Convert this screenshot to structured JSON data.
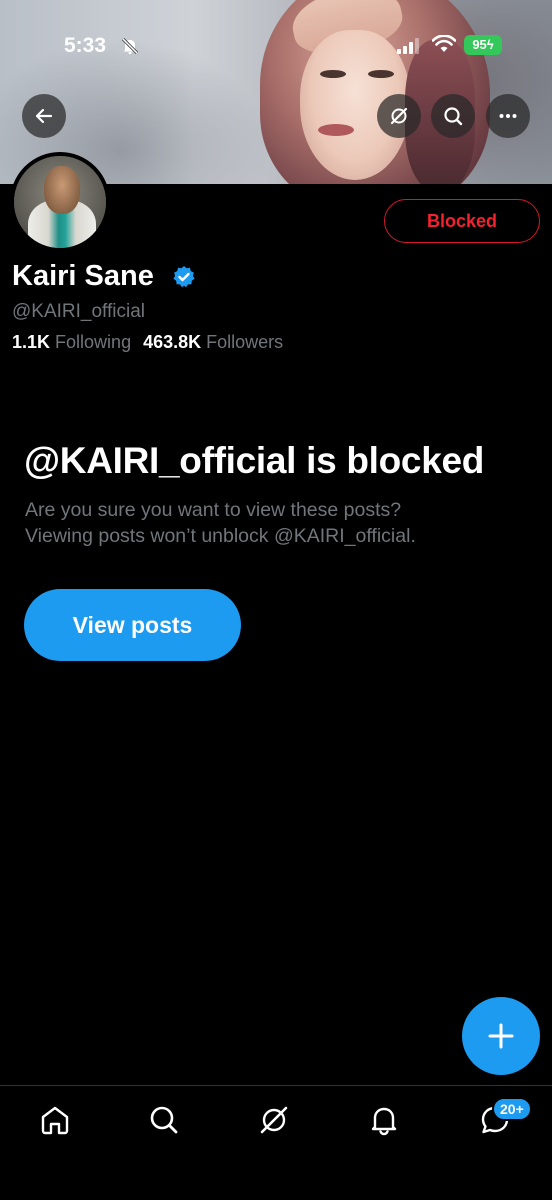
{
  "status_bar": {
    "time": "5:33",
    "battery": "95"
  },
  "profile": {
    "display_name": "Kairi Sane",
    "handle": "@KAIRI_official",
    "following_count": "1.1K",
    "following_label": "Following",
    "followers_count": "463.8K",
    "followers_label": "Followers",
    "blocked_button_label": "Blocked"
  },
  "blocked_notice": {
    "title": "@KAIRI_official is blocked",
    "line1": "Are you sure you want to view these posts?",
    "line2": "Viewing posts won’t unblock @KAIRI_official.",
    "view_posts_label": "View posts"
  },
  "bottom_nav": {
    "items": [
      "home-icon",
      "search-icon",
      "grok-icon",
      "notifications-icon",
      "messages-icon"
    ],
    "messages_badge": "20+"
  },
  "colors": {
    "accent": "#1d9bf0",
    "blocked_red": "#f4212e",
    "muted_text": "#71767b",
    "verified_blue": "#1d9bf0",
    "battery_green": "#34c759"
  },
  "icons": {
    "back": "back-arrow-icon",
    "grok": "grok-icon",
    "search": "search-icon",
    "more": "more-icon",
    "compose": "plus-icon"
  }
}
